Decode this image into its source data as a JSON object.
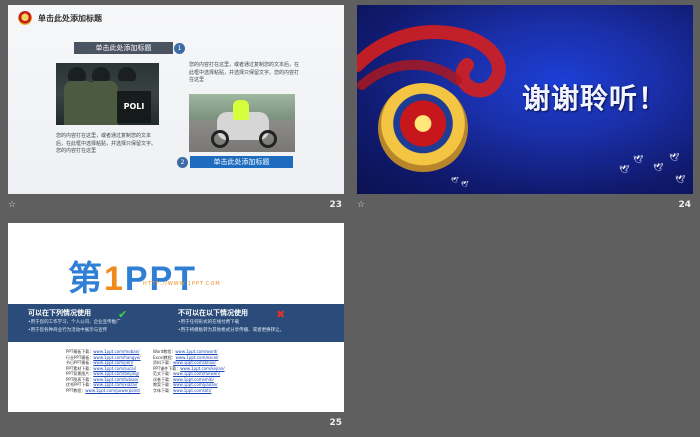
{
  "slides": [
    {
      "number": "23",
      "title": "单击此处添加标题",
      "headline_1": "单击此处添加标题",
      "bullet_1": "1",
      "text_right": "您的内容打在这里，或者通过复制您的文本后，在此框中选择粘贴，并选择只保留文字。您的内容打在这里",
      "text_left": "您的内容打在这里，或者通过复制您的文本后，在此框中选择粘贴，并选择只保留文字。您的内容打在这里",
      "shield_text": "POLI",
      "bullet_2": "2",
      "headline_2": "单击此处添加标题"
    },
    {
      "number": "24",
      "thanks": "谢谢聆听！"
    },
    {
      "number": "25",
      "logo_ch": "第",
      "logo_one": "1",
      "logo_ppt": "PPT",
      "logo_url": "HTTP://WWW.1PPT.COM",
      "allowed_title": "可以在下列情况使用",
      "allowed_line_1": "•用于您的工作学习、个人公司、企业宣传推广",
      "allowed_line_2": "•用于您各种商业行为活动中展示与宣传",
      "not_allowed_title": "不可以在以下情况使用",
      "not_allowed_line_1": "•用于任何形式的在线付费下载",
      "not_allowed_line_2": "•用于将模板转为其他格式分享传播、或者更换转让。"
    }
  ],
  "links_left": [
    {
      "label": "PPT模板下载：",
      "url": "www.1ppt.com/moban/"
    },
    {
      "label": "行业PPT模板：",
      "url": "www.1ppt.com/hangye/"
    },
    {
      "label": "节日PPT模板：",
      "url": "www.1ppt.com/jieri/"
    },
    {
      "label": "PPT素材下载：",
      "url": "www.1ppt.com/sucai/"
    },
    {
      "label": "PPT背景图片：",
      "url": "www.1ppt.com/beijing/"
    },
    {
      "label": "PPT图表下载：",
      "url": "www.1ppt.com/tubiao/"
    },
    {
      "label": "优秀PPT下载：",
      "url": "www.1ppt.com/xiazai/"
    },
    {
      "label": "PPT教程：",
      "url": "www.1ppt.com/powerpoint/"
    }
  ],
  "links_right": [
    {
      "label": "Word教程：",
      "url": "www.1ppt.com/word/"
    },
    {
      "label": "Excel教程：",
      "url": "www.1ppt.com/excel/"
    },
    {
      "label": "资料下载：",
      "url": "www.1ppt.com/ziliao/"
    },
    {
      "label": "PPT课件下载：",
      "url": "www.1ppt.com/kejian/"
    },
    {
      "label": "范文下载：",
      "url": "www.1ppt.com/fanwen/"
    },
    {
      "label": "试卷下载：",
      "url": "www.1ppt.com/shiti/"
    },
    {
      "label": "教案下载：",
      "url": "www.1ppt.com/jiaoan/"
    },
    {
      "label": "字体下载：",
      "url": "www.1ppt.com/ziti/"
    }
  ],
  "meta": {
    "star_icon": "☆",
    "colors": {
      "background": "#5f5f5f",
      "accent_blue": "#1d6cc0",
      "logo_orange": "#f08a1c"
    }
  }
}
